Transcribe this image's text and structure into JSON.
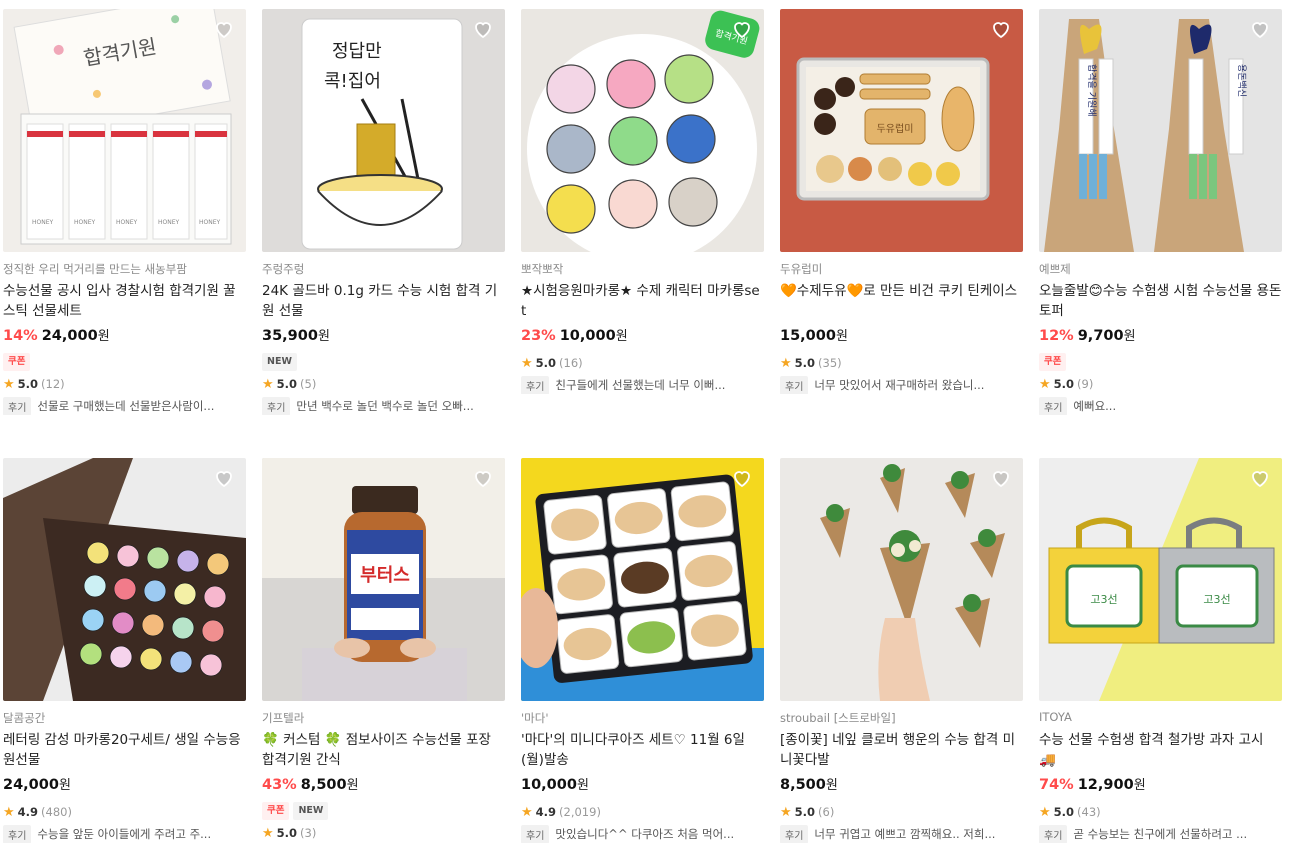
{
  "rating_star": "★",
  "heart_icon": "heart-outline-icon",
  "accent_color": "#ff4b4b",
  "products": [
    {
      "seller": "정직한 우리 먹거리를 만드는 새농부팜",
      "title": "수능선물 공시 입사 경찰시험 합격기원 꿀스틱 선물세트",
      "discount": "14%",
      "price": "24,000",
      "won": "원",
      "badges": [
        "쿠폰"
      ],
      "rating": "5.0",
      "rating_count": "(12)",
      "review_tag": "후기",
      "review": "선물로 구매했는데 선물받은사람이..."
    },
    {
      "seller": "주렁주렁",
      "title": "24K 골드바 0.1g 카드 수능 시험 합격 기원 선물",
      "discount": "",
      "price": "35,900",
      "won": "원",
      "badges": [
        "NEW"
      ],
      "rating": "5.0",
      "rating_count": "(5)",
      "review_tag": "후기",
      "review": "만년 백수로 놀던 백수로 놀던 오빠..."
    },
    {
      "seller": "뽀작뽀작",
      "title": "★시험응원마카롱★ 수제 캐릭터 마카롱set",
      "discount": "23%",
      "price": "10,000",
      "won": "원",
      "badges": [],
      "rating": "5.0",
      "rating_count": "(16)",
      "review_tag": "후기",
      "review": "친구들에게 선물했는데 너무 이뻐..."
    },
    {
      "seller": "두유럽미",
      "title": "🧡수제두유🧡로 만든 비건 쿠키 틴케이스",
      "discount": "",
      "price": "15,000",
      "won": "원",
      "badges": [],
      "rating": "5.0",
      "rating_count": "(35)",
      "review_tag": "후기",
      "review": "너무 맛있어서 재구매하러 왔습니..."
    },
    {
      "seller": "예쁘제",
      "title": "오늘줄발😊수능 수험생 시험 수능선물 용돈토퍼",
      "discount": "12%",
      "price": "9,700",
      "won": "원",
      "badges": [
        "쿠폰"
      ],
      "rating": "5.0",
      "rating_count": "(9)",
      "review_tag": "후기",
      "review": "예뻐요..."
    },
    {
      "seller": "달콤공간",
      "title": "레터링 감성 마카롱20구세트/ 생일 수능응원선물",
      "discount": "",
      "price": "24,000",
      "won": "원",
      "badges": [],
      "rating": "4.9",
      "rating_count": "(480)",
      "review_tag": "후기",
      "review": "수능을 앞둔 아이들에게 주려고 주..."
    },
    {
      "seller": "기프텔라",
      "title": "🍀 커스텀 🍀 점보사이즈 수능선물 포장 합격기원 간식",
      "discount": "43%",
      "price": "8,500",
      "won": "원",
      "badges": [
        "쿠폰",
        "NEW"
      ],
      "rating": "5.0",
      "rating_count": "(3)",
      "review_tag": "",
      "review": ""
    },
    {
      "seller": "'마다'",
      "title": "'마다'의 미니다쿠아즈 세트♡ 11월 6일(월)발송",
      "discount": "",
      "price": "10,000",
      "won": "원",
      "badges": [],
      "rating": "4.9",
      "rating_count": "(2,019)",
      "review_tag": "후기",
      "review": "맛있습니다^^ 다쿠아즈 처음 먹어..."
    },
    {
      "seller": "stroubail [스트로바일]",
      "title": "[종이꽃] 네잎 클로버 행운의 수능 합격 미니꽃다발",
      "discount": "",
      "price": "8,500",
      "won": "원",
      "badges": [],
      "rating": "5.0",
      "rating_count": "(6)",
      "review_tag": "후기",
      "review": "너무 귀엽고 예쁘고 깜찍해요.. 저희..."
    },
    {
      "seller": "ITOYA",
      "title": "수능 선물 수험생 합격 철가방 과자 고시 🚚",
      "discount": "74%",
      "price": "12,900",
      "won": "원",
      "badges": [],
      "rating": "5.0",
      "rating_count": "(43)",
      "review_tag": "후기",
      "review": "곧 수능보는 친구에게 선물하려고 ..."
    }
  ],
  "image_text": {
    "p1_box": "합격기원",
    "p2_card_line1": "정답만",
    "p2_card_line2": "콕!집어",
    "p3_tag": "합격기원",
    "p4_cookie": "두유럽미",
    "p5_left": "합격을 기원해",
    "p5_right": "용돈백신",
    "p7_jar": "부터스",
    "p10_box": "고3선"
  }
}
